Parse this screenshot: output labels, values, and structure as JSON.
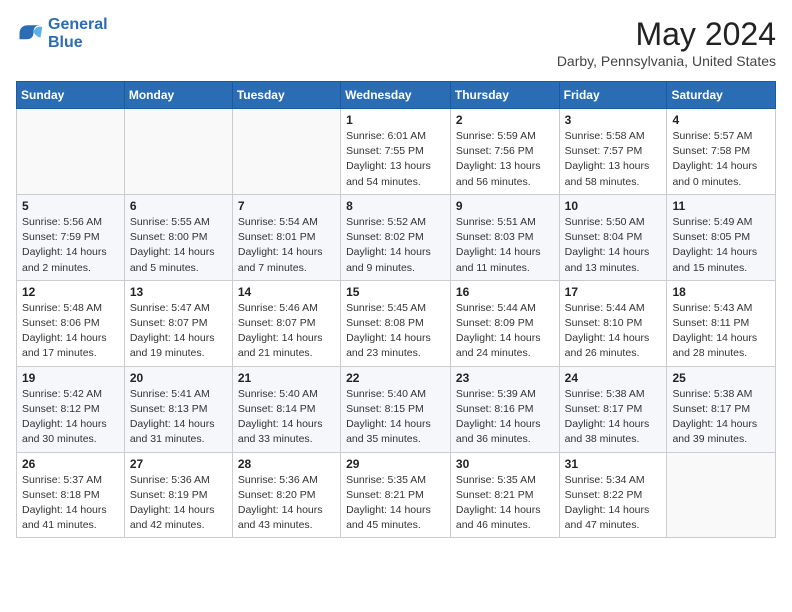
{
  "header": {
    "logo_line1": "General",
    "logo_line2": "Blue",
    "month_year": "May 2024",
    "location": "Darby, Pennsylvania, United States"
  },
  "weekdays": [
    "Sunday",
    "Monday",
    "Tuesday",
    "Wednesday",
    "Thursday",
    "Friday",
    "Saturday"
  ],
  "weeks": [
    [
      {
        "day": "",
        "info": ""
      },
      {
        "day": "",
        "info": ""
      },
      {
        "day": "",
        "info": ""
      },
      {
        "day": "1",
        "info": "Sunrise: 6:01 AM\nSunset: 7:55 PM\nDaylight: 13 hours\nand 54 minutes."
      },
      {
        "day": "2",
        "info": "Sunrise: 5:59 AM\nSunset: 7:56 PM\nDaylight: 13 hours\nand 56 minutes."
      },
      {
        "day": "3",
        "info": "Sunrise: 5:58 AM\nSunset: 7:57 PM\nDaylight: 13 hours\nand 58 minutes."
      },
      {
        "day": "4",
        "info": "Sunrise: 5:57 AM\nSunset: 7:58 PM\nDaylight: 14 hours\nand 0 minutes."
      }
    ],
    [
      {
        "day": "5",
        "info": "Sunrise: 5:56 AM\nSunset: 7:59 PM\nDaylight: 14 hours\nand 2 minutes."
      },
      {
        "day": "6",
        "info": "Sunrise: 5:55 AM\nSunset: 8:00 PM\nDaylight: 14 hours\nand 5 minutes."
      },
      {
        "day": "7",
        "info": "Sunrise: 5:54 AM\nSunset: 8:01 PM\nDaylight: 14 hours\nand 7 minutes."
      },
      {
        "day": "8",
        "info": "Sunrise: 5:52 AM\nSunset: 8:02 PM\nDaylight: 14 hours\nand 9 minutes."
      },
      {
        "day": "9",
        "info": "Sunrise: 5:51 AM\nSunset: 8:03 PM\nDaylight: 14 hours\nand 11 minutes."
      },
      {
        "day": "10",
        "info": "Sunrise: 5:50 AM\nSunset: 8:04 PM\nDaylight: 14 hours\nand 13 minutes."
      },
      {
        "day": "11",
        "info": "Sunrise: 5:49 AM\nSunset: 8:05 PM\nDaylight: 14 hours\nand 15 minutes."
      }
    ],
    [
      {
        "day": "12",
        "info": "Sunrise: 5:48 AM\nSunset: 8:06 PM\nDaylight: 14 hours\nand 17 minutes."
      },
      {
        "day": "13",
        "info": "Sunrise: 5:47 AM\nSunset: 8:07 PM\nDaylight: 14 hours\nand 19 minutes."
      },
      {
        "day": "14",
        "info": "Sunrise: 5:46 AM\nSunset: 8:07 PM\nDaylight: 14 hours\nand 21 minutes."
      },
      {
        "day": "15",
        "info": "Sunrise: 5:45 AM\nSunset: 8:08 PM\nDaylight: 14 hours\nand 23 minutes."
      },
      {
        "day": "16",
        "info": "Sunrise: 5:44 AM\nSunset: 8:09 PM\nDaylight: 14 hours\nand 24 minutes."
      },
      {
        "day": "17",
        "info": "Sunrise: 5:44 AM\nSunset: 8:10 PM\nDaylight: 14 hours\nand 26 minutes."
      },
      {
        "day": "18",
        "info": "Sunrise: 5:43 AM\nSunset: 8:11 PM\nDaylight: 14 hours\nand 28 minutes."
      }
    ],
    [
      {
        "day": "19",
        "info": "Sunrise: 5:42 AM\nSunset: 8:12 PM\nDaylight: 14 hours\nand 30 minutes."
      },
      {
        "day": "20",
        "info": "Sunrise: 5:41 AM\nSunset: 8:13 PM\nDaylight: 14 hours\nand 31 minutes."
      },
      {
        "day": "21",
        "info": "Sunrise: 5:40 AM\nSunset: 8:14 PM\nDaylight: 14 hours\nand 33 minutes."
      },
      {
        "day": "22",
        "info": "Sunrise: 5:40 AM\nSunset: 8:15 PM\nDaylight: 14 hours\nand 35 minutes."
      },
      {
        "day": "23",
        "info": "Sunrise: 5:39 AM\nSunset: 8:16 PM\nDaylight: 14 hours\nand 36 minutes."
      },
      {
        "day": "24",
        "info": "Sunrise: 5:38 AM\nSunset: 8:17 PM\nDaylight: 14 hours\nand 38 minutes."
      },
      {
        "day": "25",
        "info": "Sunrise: 5:38 AM\nSunset: 8:17 PM\nDaylight: 14 hours\nand 39 minutes."
      }
    ],
    [
      {
        "day": "26",
        "info": "Sunrise: 5:37 AM\nSunset: 8:18 PM\nDaylight: 14 hours\nand 41 minutes."
      },
      {
        "day": "27",
        "info": "Sunrise: 5:36 AM\nSunset: 8:19 PM\nDaylight: 14 hours\nand 42 minutes."
      },
      {
        "day": "28",
        "info": "Sunrise: 5:36 AM\nSunset: 8:20 PM\nDaylight: 14 hours\nand 43 minutes."
      },
      {
        "day": "29",
        "info": "Sunrise: 5:35 AM\nSunset: 8:21 PM\nDaylight: 14 hours\nand 45 minutes."
      },
      {
        "day": "30",
        "info": "Sunrise: 5:35 AM\nSunset: 8:21 PM\nDaylight: 14 hours\nand 46 minutes."
      },
      {
        "day": "31",
        "info": "Sunrise: 5:34 AM\nSunset: 8:22 PM\nDaylight: 14 hours\nand 47 minutes."
      },
      {
        "day": "",
        "info": ""
      }
    ]
  ]
}
